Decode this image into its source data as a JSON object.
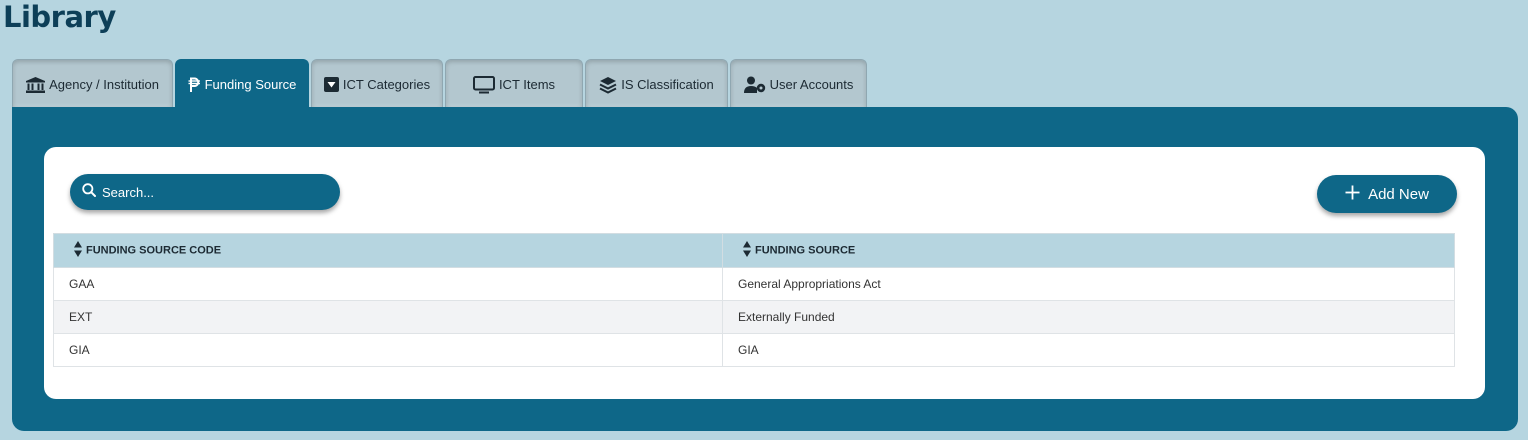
{
  "page": {
    "title": "Library"
  },
  "tabs": [
    {
      "label": "Agency / Institution",
      "icon": "bank-icon",
      "active": false
    },
    {
      "label": "Funding Source",
      "icon": "peso-icon",
      "active": true
    },
    {
      "label": "ICT Categories",
      "icon": "caret-square-down-icon",
      "active": false
    },
    {
      "label": "ICT Items",
      "icon": "monitor-icon",
      "active": false
    },
    {
      "label": "IS Classification",
      "icon": "layers-icon",
      "active": false
    },
    {
      "label": "User Accounts",
      "icon": "user-gear-icon",
      "active": false
    }
  ],
  "search": {
    "placeholder": "Search...",
    "value": ""
  },
  "toolbar": {
    "add_label": "Add New"
  },
  "table": {
    "columns": [
      "FUNDING SOURCE CODE",
      "FUNDING SOURCE"
    ],
    "rows": [
      [
        "GAA",
        "General Appropriations Act"
      ],
      [
        "EXT",
        "Externally Funded"
      ],
      [
        "GIA",
        "GIA"
      ]
    ]
  },
  "colors": {
    "background": "#b6d5e0",
    "primary": "#0e6788",
    "title": "#0d3f58",
    "tab_inactive": "#b3c7cf"
  }
}
